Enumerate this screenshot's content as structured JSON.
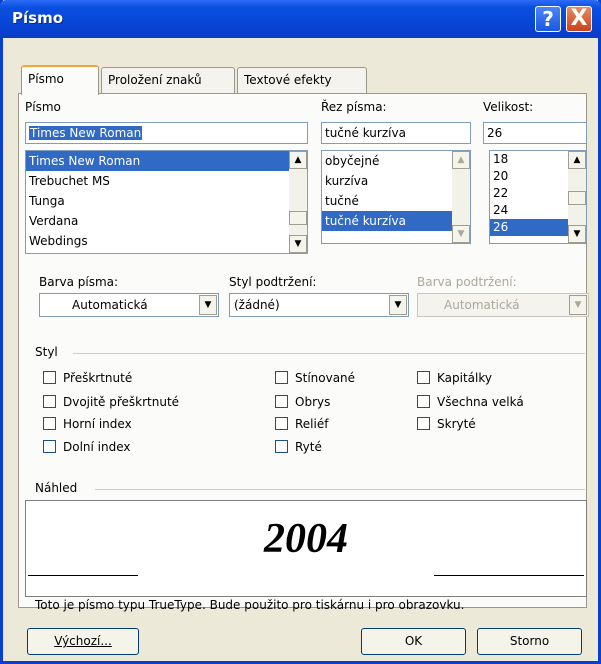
{
  "window": {
    "title": "Písmo",
    "help_glyph": "?",
    "close_glyph": "X"
  },
  "tabs": [
    {
      "label": "Písmo",
      "active": true
    },
    {
      "label": "Proložení znaků",
      "active": false
    },
    {
      "label": "Textové efekty",
      "active": false
    }
  ],
  "font": {
    "label": "Písmo",
    "value": "Times New Roman",
    "list": [
      "Times New Roman",
      "Trebuchet MS",
      "Tunga",
      "Verdana",
      "Webdings"
    ],
    "selected_index": 0
  },
  "style": {
    "label": "Řez písma:",
    "value": "tučné kurzíva",
    "list": [
      "obyčejné",
      "kurzíva",
      "tučné",
      "tučné kurzíva"
    ],
    "selected_index": 3
  },
  "size": {
    "label": "Velikost:",
    "value": "26",
    "list": [
      "18",
      "20",
      "22",
      "24",
      "26"
    ],
    "selected_index": 4
  },
  "color": {
    "label": "Barva písma:",
    "value": "Automatická"
  },
  "underline_style": {
    "label": "Styl podtržení:",
    "value": "(žádné)"
  },
  "underline_color": {
    "label": "Barva podtržení:",
    "value": "Automatická",
    "disabled": true
  },
  "effects": {
    "label": "Styl",
    "col1": [
      "Přeškrtnuté",
      "Dvojitě přeškrtnuté",
      "Horní index",
      "Dolní index"
    ],
    "col2": [
      "Stínované",
      "Obrys",
      "Reliéf",
      "Ryté"
    ],
    "col3": [
      "Kapitálky",
      "Všechna velká",
      "Skryté"
    ]
  },
  "preview": {
    "label": "Náhled",
    "sample": "2004",
    "note": "Toto je písmo typu TrueType. Bude použito pro tiskárnu i pro obrazovku."
  },
  "buttons": {
    "default": "Výchozí...",
    "ok": "OK",
    "cancel": "Storno"
  },
  "colors": {
    "titlebar": "#0846d8",
    "selection": "#316ac5",
    "dialog_bg": "#ece9d8"
  }
}
